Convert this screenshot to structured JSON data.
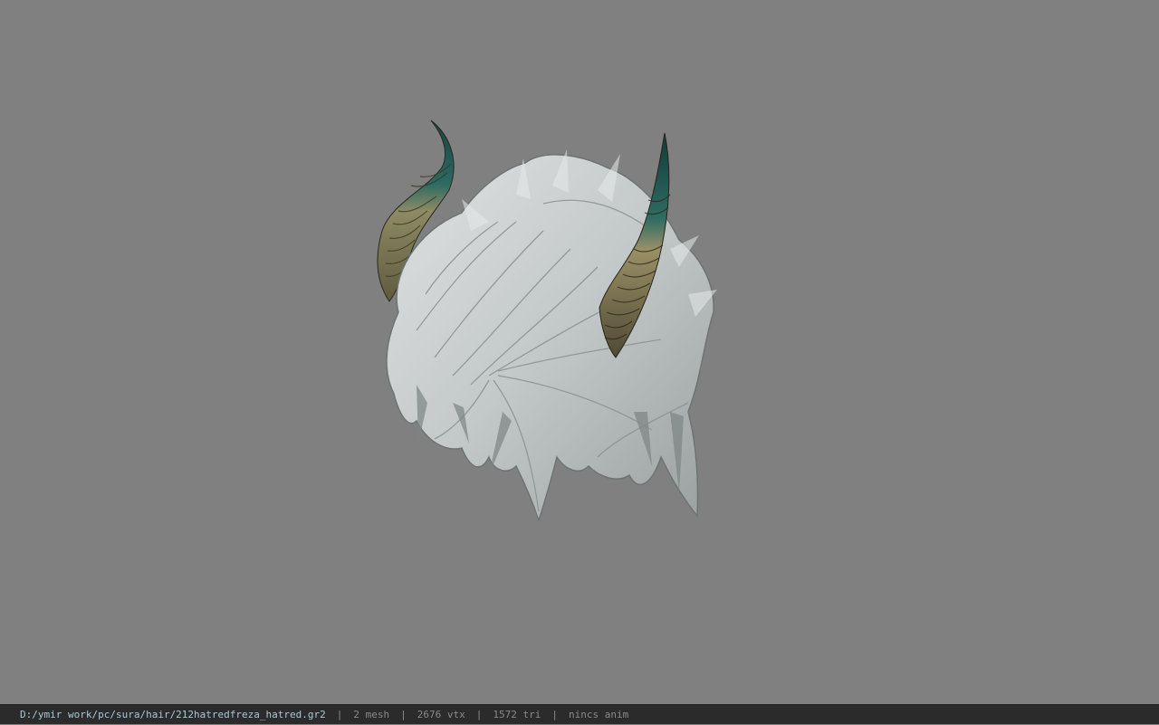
{
  "viewport": {
    "background": "#808080",
    "model": {
      "icon": "horned-hair-model",
      "hair_color": "#c9cdcd",
      "horn_tip_color": "#1f5a55",
      "horn_base_color": "#a99a6a"
    }
  },
  "statusbar": {
    "file_path": "D:/ymir work/pc/sura/hair/212hatredfreza_hatred.gr2",
    "separator": "|",
    "mesh": "2 mesh",
    "vertices": "2676 vtx",
    "triangles": "1572 tri",
    "animation": "nincs anim",
    "path_color": "#a9c8d6"
  }
}
